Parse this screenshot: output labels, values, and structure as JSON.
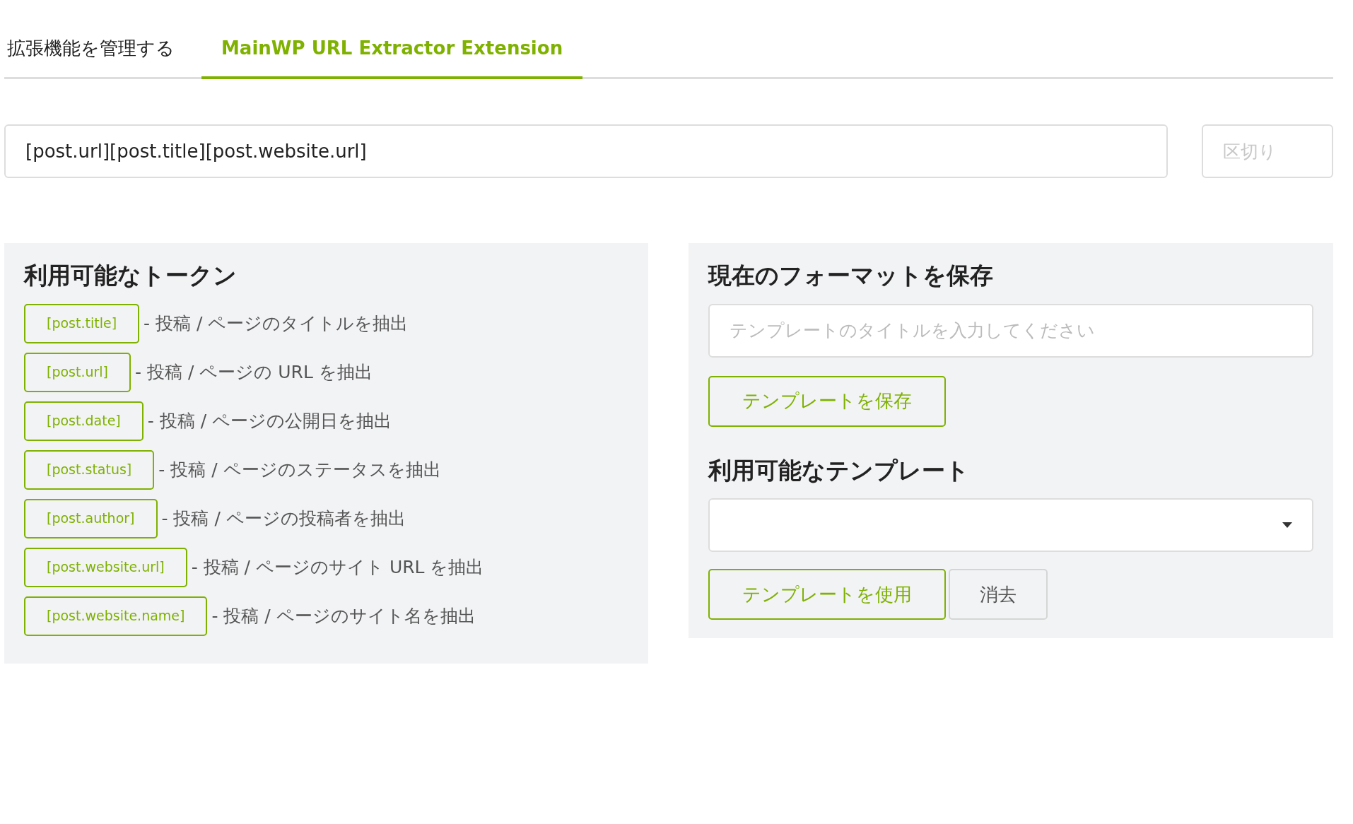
{
  "tabs": [
    {
      "label": "拡張機能を管理する",
      "selected": false
    },
    {
      "label": "MainWP URL Extractor Extension",
      "selected": true
    }
  ],
  "format_field": {
    "value": "[post.url][post.title][post.website.url]"
  },
  "delimiter_field": {
    "placeholder": "区切り"
  },
  "tokens_panel": {
    "title": "利用可能なトークン",
    "tokens": [
      {
        "token": "[post.title]",
        "description": "- 投稿 / ページのタイトルを抽出"
      },
      {
        "token": "[post.url]",
        "description": "- 投稿 / ページの URL を抽出"
      },
      {
        "token": "[post.date]",
        "description": "- 投稿 / ページの公開日を抽出"
      },
      {
        "token": "[post.status]",
        "description": "- 投稿 / ページのステータスを抽出"
      },
      {
        "token": "[post.author]",
        "description": "- 投稿 / ページの投稿者を抽出"
      },
      {
        "token": "[post.website.url]",
        "description": "- 投稿 / ページのサイト URL を抽出"
      },
      {
        "token": "[post.website.name]",
        "description": "- 投稿 / ページのサイト名を抽出"
      }
    ]
  },
  "save_panel": {
    "title": "現在のフォーマットを保存",
    "title_field": {
      "placeholder": "テンプレートのタイトルを入力してください"
    },
    "buttons": [
      {
        "label": "テンプレートを保存",
        "kind": "primary"
      }
    ]
  },
  "templates_panel": {
    "title": "利用可能なテンプレート",
    "buttons": [
      {
        "label": "テンプレートを使用",
        "kind": "primary"
      },
      {
        "label": "消去",
        "kind": "secondary"
      }
    ]
  }
}
